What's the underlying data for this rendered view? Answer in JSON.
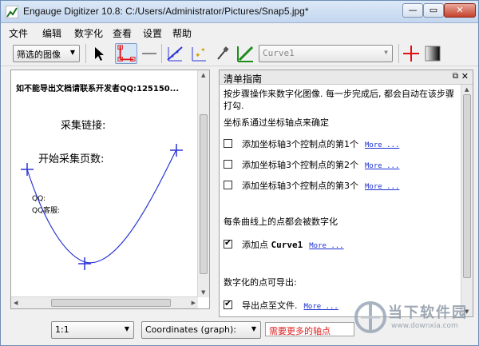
{
  "window": {
    "title": "Engauge Digitizer 10.8: C:/Users/Administrator/Pictures/Snap5.jpg*",
    "min_label": "—",
    "max_label": "▭",
    "close_label": "✕"
  },
  "menubar": {
    "items": [
      {
        "label": "文件"
      },
      {
        "label": "编辑"
      },
      {
        "label": "数字化"
      },
      {
        "label": "查看"
      },
      {
        "label": "设置"
      },
      {
        "label": "帮助"
      }
    ]
  },
  "toolbar": {
    "view_select": "筛选的图像",
    "curve_select": "Curve1",
    "icons": [
      "pointer-icon",
      "axis-point-icon",
      "segment-icon",
      "point-match-icon",
      "color-picker-icon",
      "curve-digitize-icon",
      "crosshair-icon",
      "gradient-icon"
    ]
  },
  "graph": {
    "header_text": "如不能导出文档请联系开发者QQ:125150...",
    "collect_link_label": "采集链接:",
    "collect_pages_label": "开始采集页数:",
    "qq_label": "QQ:",
    "qq_service_label": "QQ客服:",
    "curve_color": "#2a34d6",
    "marker_color": "#2a34d6"
  },
  "checklist": {
    "title": "清单指南",
    "float_icon": "⧉",
    "close_icon": "✕",
    "intro": "按步骤操作来数字化图像. 每一步完成后, 都会自动在该步骤打勾.",
    "section1": "坐标系通过坐标轴点来确定",
    "steps_axis": [
      {
        "label": "添加坐标轴3个控制点的第1个",
        "more": "More ...",
        "checked": false
      },
      {
        "label": "添加坐标轴3个控制点的第2个",
        "more": "More ...",
        "checked": false
      },
      {
        "label": "添加坐标轴3个控制点的第3个",
        "more": "More ...",
        "checked": false
      }
    ],
    "section2": "每条曲线上的点都会被数字化",
    "step_points": {
      "label_prefix": "添加点",
      "curve": "Curve1",
      "more": "More ...",
      "checked": true
    },
    "section3": "数字化的点可导出:",
    "step_export": {
      "label": "导出点至文件.",
      "more": "More ...",
      "checked": true
    }
  },
  "statusbar": {
    "zoom": "1:1",
    "coords_mode": "Coordinates (graph):",
    "warning": "需要更多的轴点"
  },
  "watermark": {
    "brand": "当下软件园",
    "url": "www.downxia.com"
  }
}
